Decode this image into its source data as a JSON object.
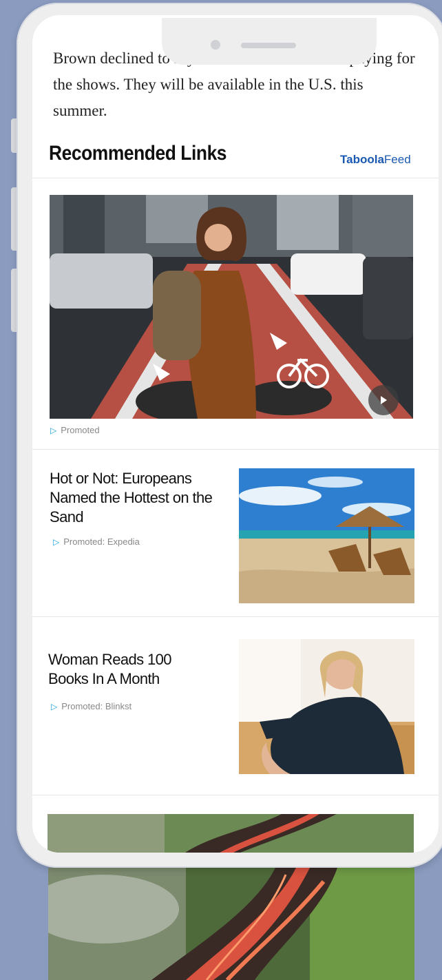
{
  "article": {
    "text": "Brown declined to say how much Facebook is paying for the shows. They will be available in the U.S. this summer."
  },
  "feed": {
    "heading": "Recommended Links",
    "brand_prefix": "Tab",
    "brand_mid": "oola",
    "brand_suffix": "Feed"
  },
  "hero": {
    "promo_label": "Promoted",
    "image": "woman-with-backpack-on-city-bike-lane",
    "play_icon": "play-icon"
  },
  "cards": [
    {
      "title": "Hot or Not: Europeans Named the Hottest on the Sand",
      "promo_label": "Promoted: Expedia",
      "image": "beach-umbrella-and-loungers"
    },
    {
      "title": "Woman Reads 100 Books In A Month",
      "promo_label": "Promoted: Blinkst",
      "image": "smiling-woman-on-sofa"
    }
  ],
  "next_card": {
    "image": "aerial-lava-flow"
  },
  "colors": {
    "background": "#8a9bbf",
    "phone_frame": "#eeeeee",
    "taboola_blue": "#1a59b3",
    "promo_icon": "#19a3d8"
  }
}
